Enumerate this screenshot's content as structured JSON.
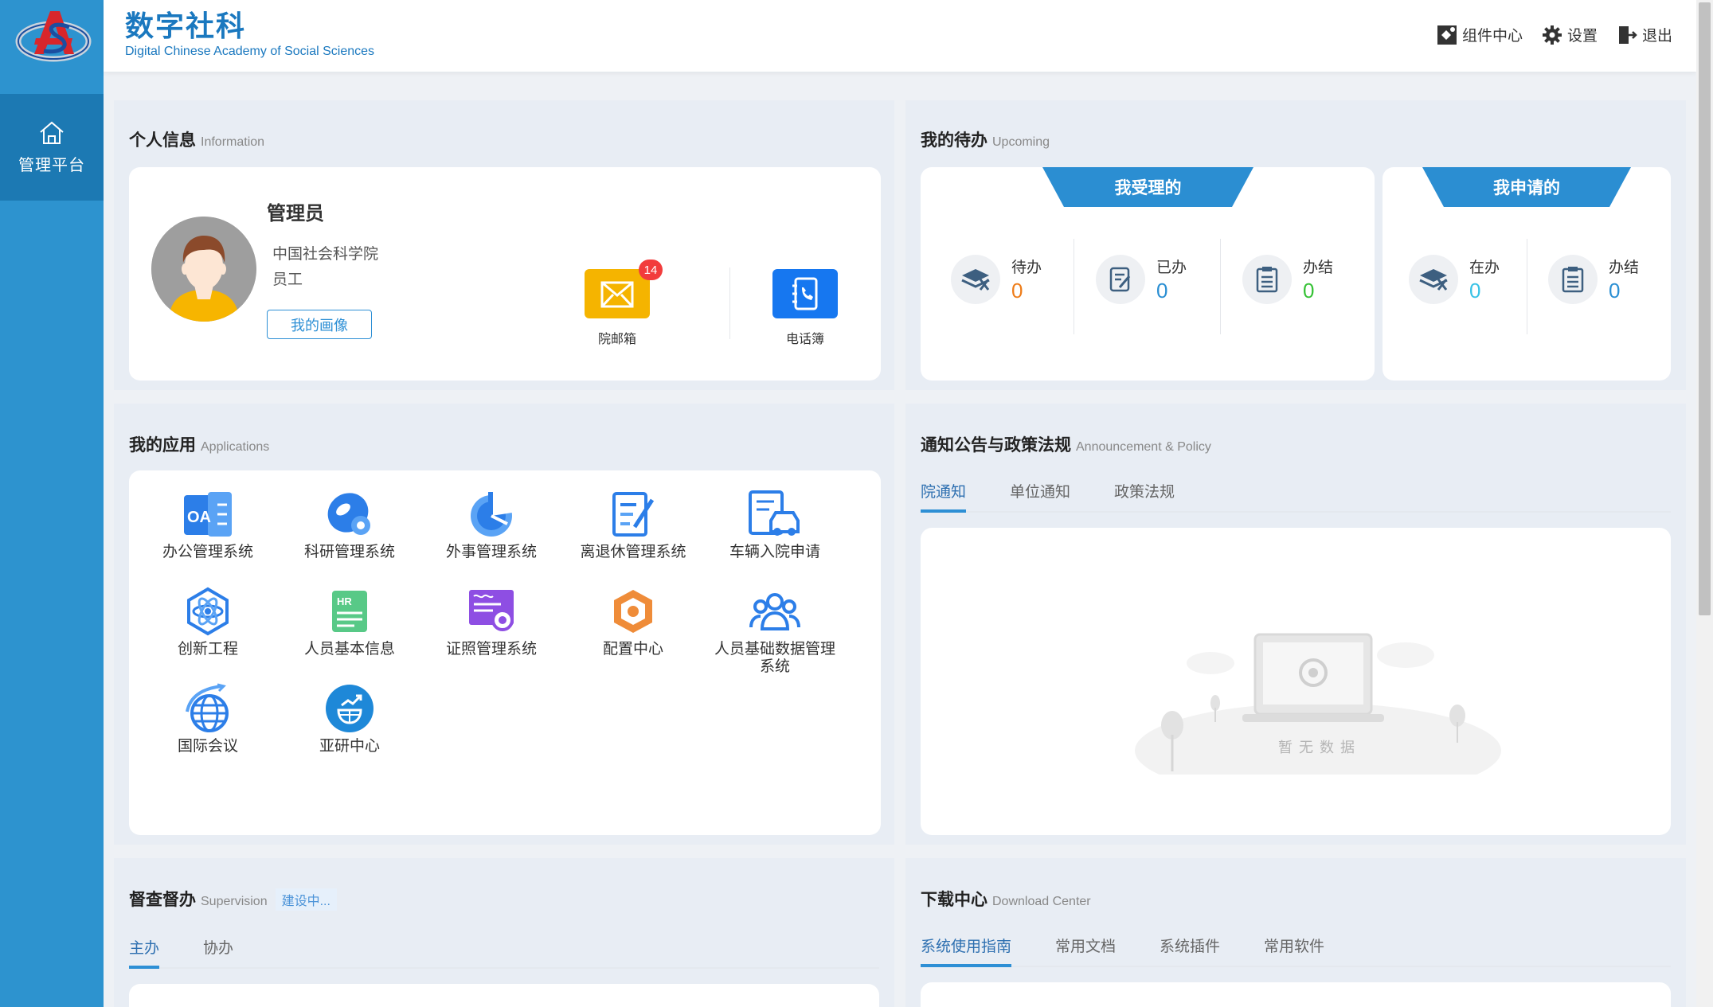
{
  "header": {
    "title": "数字社科",
    "subtitle": "Digital Chinese Academy of Social Sciences",
    "actions": {
      "components": "组件中心",
      "settings": "设置",
      "logout": "退出"
    }
  },
  "sidebar": {
    "items": [
      {
        "label": "管理平台",
        "icon": "home-icon"
      }
    ]
  },
  "personal": {
    "title": "个人信息",
    "title_en": "Information",
    "name": "管理员",
    "org": "中国社会科学院",
    "role": "员工",
    "portrait_button": "我的画像",
    "mailbox": {
      "label": "院邮箱",
      "badge": "14"
    },
    "phonebook": {
      "label": "电话簿"
    }
  },
  "upcoming": {
    "title": "我的待办",
    "title_en": "Upcoming",
    "received": {
      "label": "我受理的",
      "stats": [
        {
          "label": "待办",
          "value": "0",
          "color": "#ee7d1a"
        },
        {
          "label": "已办",
          "value": "0",
          "color": "#2b8fd3"
        },
        {
          "label": "办结",
          "value": "0",
          "color": "#36c236"
        }
      ]
    },
    "applied": {
      "label": "我申请的",
      "stats": [
        {
          "label": "在办",
          "value": "0",
          "color": "#39c2e6"
        },
        {
          "label": "办结",
          "value": "0",
          "color": "#2b8fd3"
        }
      ]
    }
  },
  "apps": {
    "title": "我的应用",
    "title_en": "Applications",
    "items": [
      {
        "label": "办公管理系统",
        "icon": "oa-icon"
      },
      {
        "label": "科研管理系统",
        "icon": "research-icon"
      },
      {
        "label": "外事管理系统",
        "icon": "foreign-affairs-icon"
      },
      {
        "label": "离退休管理系统",
        "icon": "retirement-icon"
      },
      {
        "label": "车辆入院申请",
        "icon": "vehicle-icon"
      },
      {
        "label": "创新工程",
        "icon": "atom-icon"
      },
      {
        "label": "人员基本信息",
        "icon": "hr-icon"
      },
      {
        "label": "证照管理系统",
        "icon": "certificate-icon"
      },
      {
        "label": "配置中心",
        "icon": "hexagon-icon"
      },
      {
        "label": "人员基础数据管理系统",
        "icon": "people-icon"
      },
      {
        "label": "国际会议",
        "icon": "globe-icon"
      },
      {
        "label": "亚研中心",
        "icon": "asia-globe-icon"
      }
    ]
  },
  "notice": {
    "title": "通知公告与政策法规",
    "title_en": "Announcement & Policy",
    "tabs": [
      "院通知",
      "单位通知",
      "政策法规"
    ],
    "empty": "暂无数据"
  },
  "supervision": {
    "title": "督查督办",
    "title_en": "Supervision",
    "status": "建设中...",
    "tabs": [
      "主办",
      "协办"
    ]
  },
  "download": {
    "title": "下载中心",
    "title_en": "Download Center",
    "tabs": [
      "系统使用指南",
      "常用文档",
      "系统插件",
      "常用软件"
    ]
  }
}
